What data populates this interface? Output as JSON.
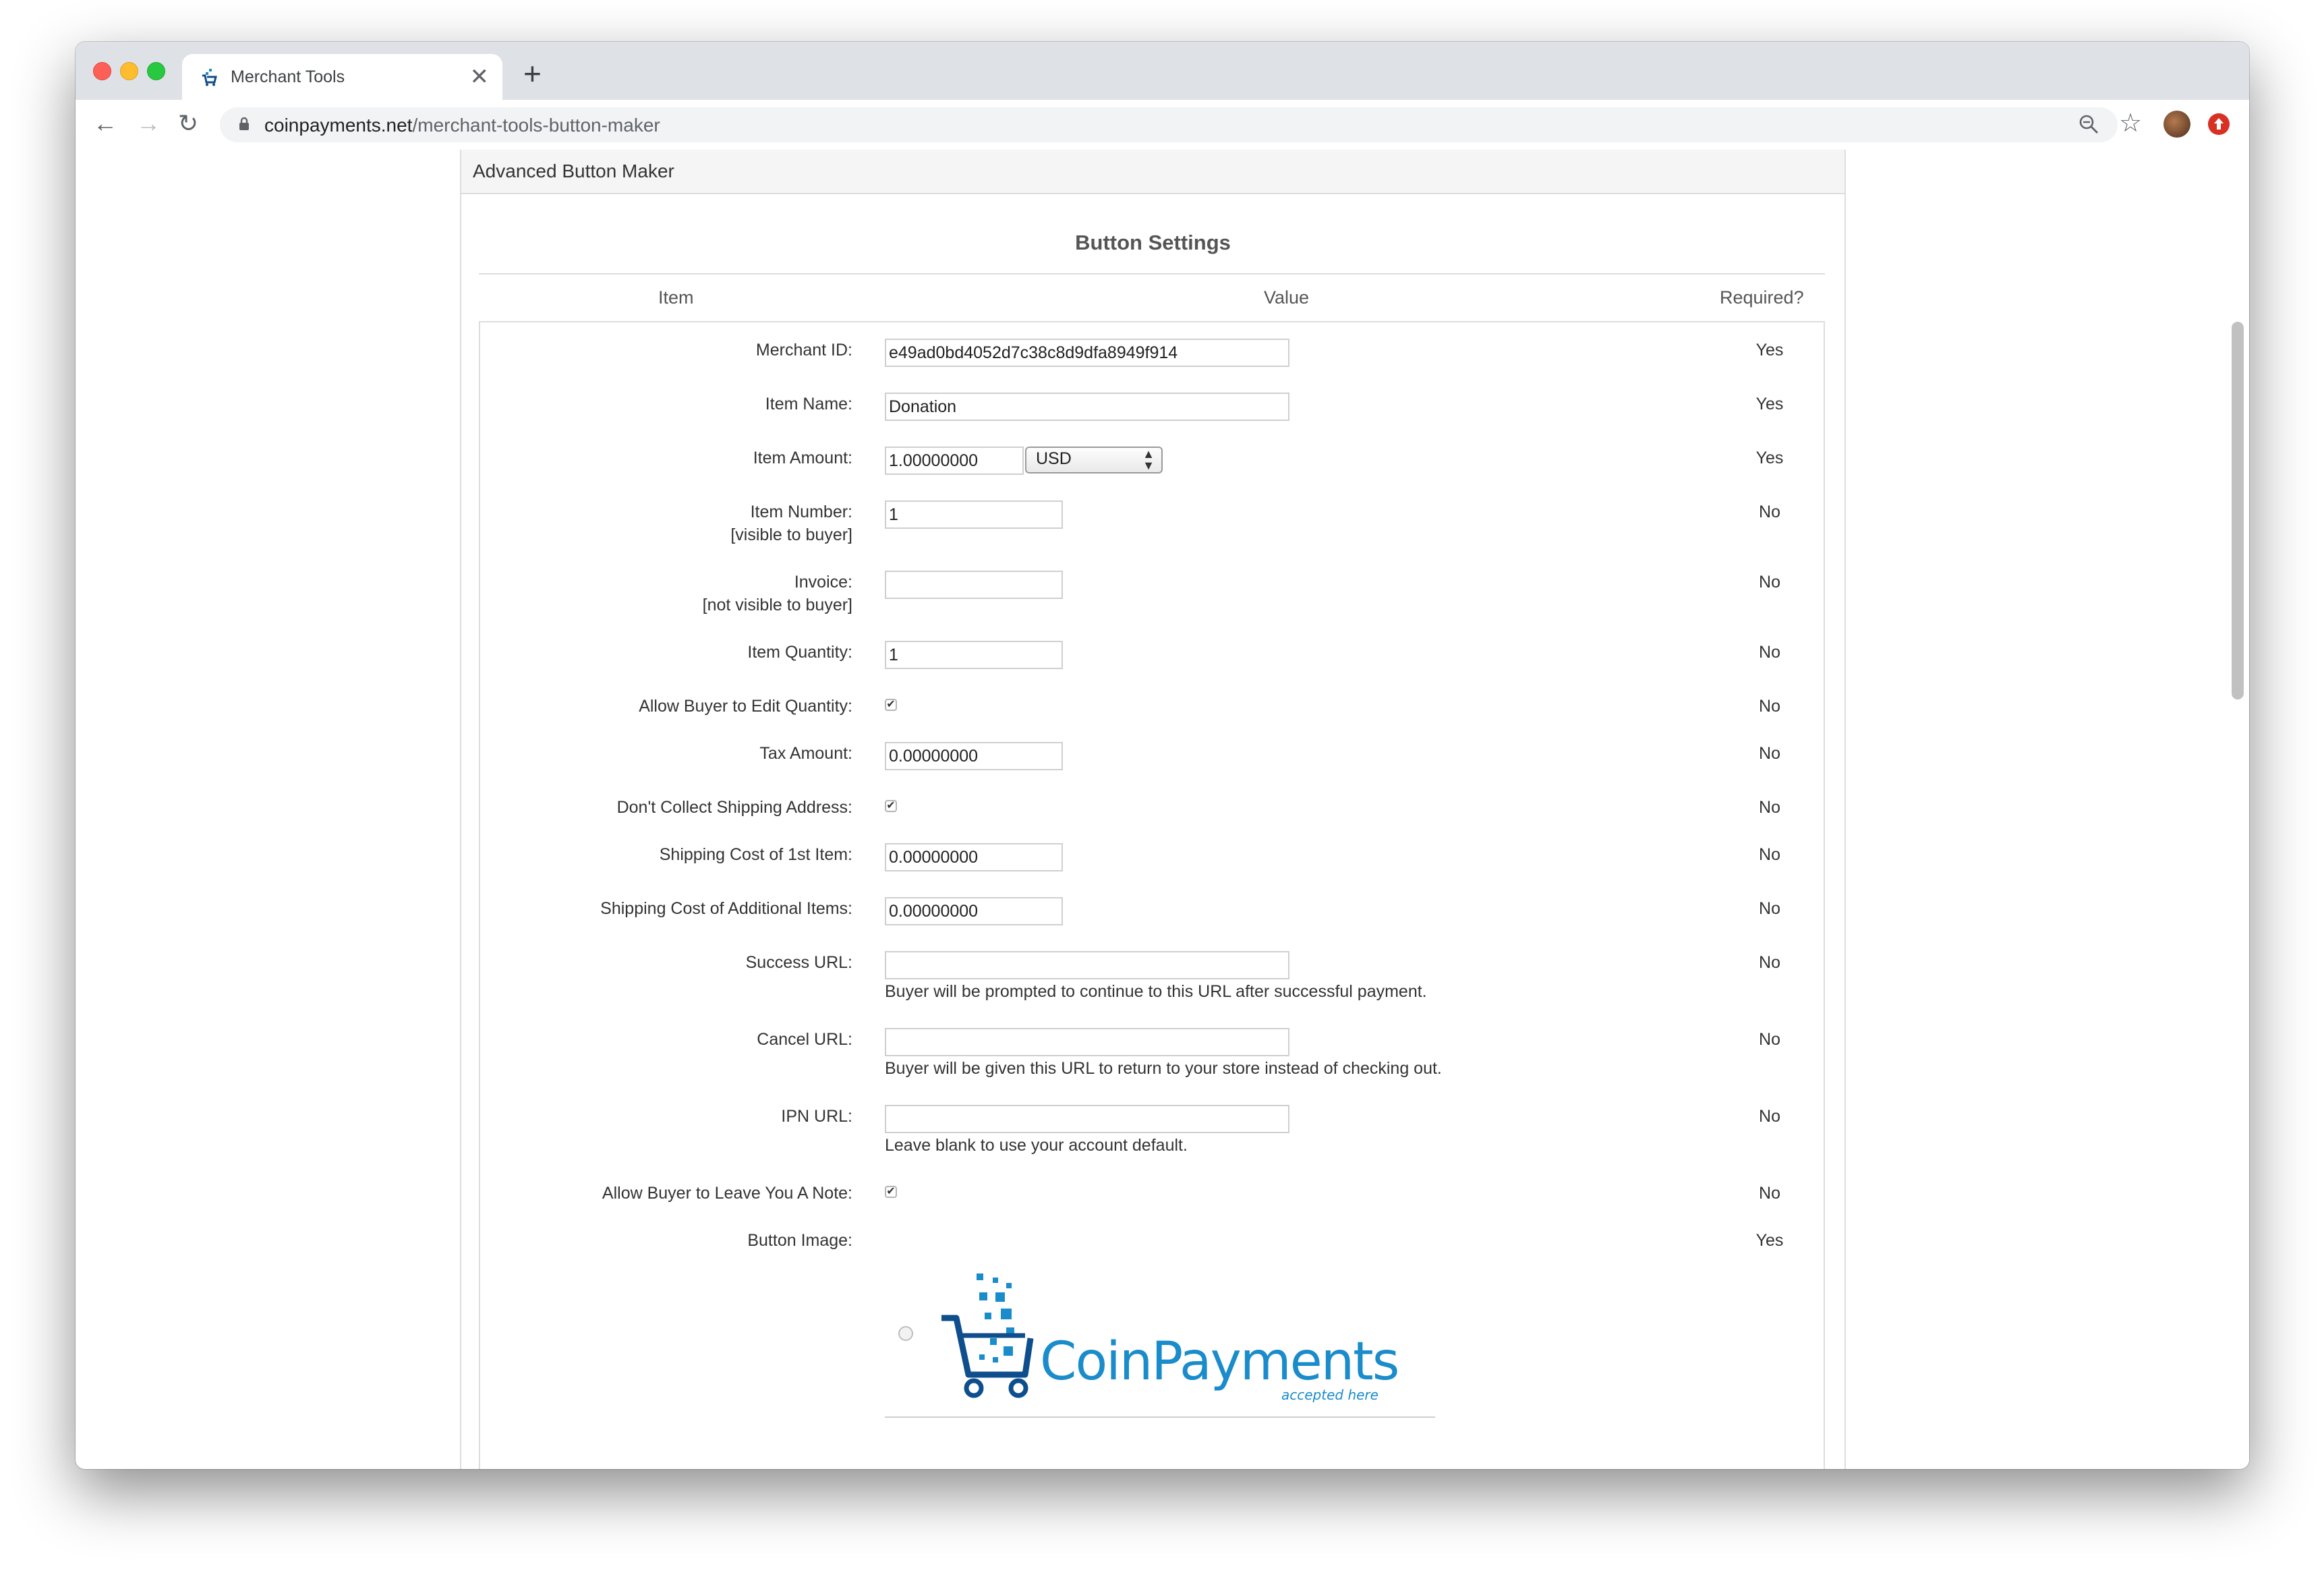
{
  "browser": {
    "tab_title": "Merchant Tools",
    "new_tab_symbol": "+",
    "close_symbol": "✕",
    "url_host": "coinpayments.net",
    "url_path": "/merchant-tools-button-maker"
  },
  "panel": {
    "heading": "Advanced Button Maker",
    "section_title": "Button Settings",
    "columns": {
      "item": "Item",
      "value": "Value",
      "required": "Required?"
    }
  },
  "rows": {
    "merchant_id": {
      "label": "Merchant ID:",
      "value": "e49ad0bd4052d7c38c8d9dfa8949f914",
      "required": "Yes"
    },
    "item_name": {
      "label": "Item Name:",
      "value": "Donation",
      "required": "Yes"
    },
    "item_amount": {
      "label": "Item Amount:",
      "value": "1.00000000",
      "currency": "USD",
      "required": "Yes"
    },
    "item_number": {
      "label": "Item Number:",
      "sublabel": "[visible to buyer]",
      "value": "1",
      "required": "No"
    },
    "invoice": {
      "label": "Invoice:",
      "sublabel": "[not visible to buyer]",
      "value": "",
      "required": "No"
    },
    "item_quantity": {
      "label": "Item Quantity:",
      "value": "1",
      "required": "No"
    },
    "allow_edit_quantity": {
      "label": "Allow Buyer to Edit Quantity:",
      "checked": true,
      "required": "No"
    },
    "tax_amount": {
      "label": "Tax Amount:",
      "value": "0.00000000",
      "required": "No"
    },
    "no_shipping": {
      "label": "Don't Collect Shipping Address:",
      "checked": true,
      "required": "No"
    },
    "shipping_1st": {
      "label": "Shipping Cost of 1st Item:",
      "value": "0.00000000",
      "required": "No"
    },
    "shipping_add": {
      "label": "Shipping Cost of Additional Items:",
      "value": "0.00000000",
      "required": "No"
    },
    "success_url": {
      "label": "Success URL:",
      "value": "",
      "hint": "Buyer will be prompted to continue to this URL after successful payment.",
      "required": "No"
    },
    "cancel_url": {
      "label": "Cancel URL:",
      "value": "",
      "hint": "Buyer will be given this URL to return to your store instead of checking out.",
      "required": "No"
    },
    "ipn_url": {
      "label": "IPN URL:",
      "value": "",
      "hint": "Leave blank to use your account default.",
      "required": "No"
    },
    "allow_note": {
      "label": "Allow Buyer to Leave You A Note:",
      "checked": true,
      "required": "No"
    },
    "button_image": {
      "label": "Button Image:",
      "required": "Yes"
    }
  },
  "logo": {
    "text": "CoinPayments",
    "subtext": "accepted here"
  },
  "colors": {
    "brand_blue": "#1a8ccb",
    "brand_dark": "#0f4e8c"
  }
}
